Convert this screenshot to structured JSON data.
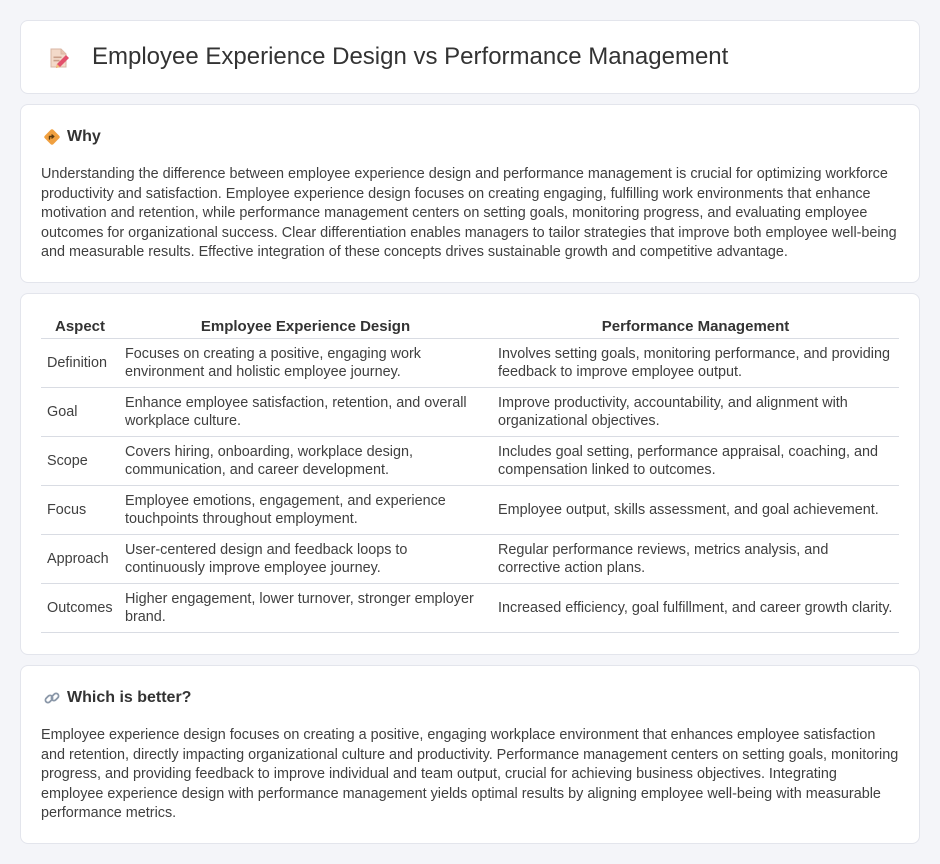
{
  "header": {
    "title": "Employee Experience Design vs Performance Management",
    "icon": "document-pencil-icon"
  },
  "why": {
    "title": "Why",
    "icon": "diamond-direction-icon",
    "text": "Understanding the difference between employee experience design and performance management is crucial for optimizing workforce productivity and satisfaction. Employee experience design focuses on creating engaging, fulfilling work environments that enhance motivation and retention, while performance management centers on setting goals, monitoring progress, and evaluating employee outcomes for organizational success. Clear differentiation enables managers to tailor strategies that improve both employee well-being and measurable results. Effective integration of these concepts drives sustainable growth and competitive advantage."
  },
  "table": {
    "headers": [
      "Aspect",
      "Employee Experience Design",
      "Performance Management"
    ],
    "rows": [
      [
        "Definition",
        "Focuses on creating a positive, engaging work environment and holistic employee journey.",
        "Involves setting goals, monitoring performance, and providing feedback to improve employee output."
      ],
      [
        "Goal",
        "Enhance employee satisfaction, retention, and overall workplace culture.",
        "Improve productivity, accountability, and alignment with organizational objectives."
      ],
      [
        "Scope",
        "Covers hiring, onboarding, workplace design, communication, and career development.",
        "Includes goal setting, performance appraisal, coaching, and compensation linked to outcomes."
      ],
      [
        "Focus",
        "Employee emotions, engagement, and experience touchpoints throughout employment.",
        "Employee output, skills assessment, and goal achievement."
      ],
      [
        "Approach",
        "User-centered design and feedback loops to continuously improve employee journey.",
        "Regular performance reviews, metrics analysis, and corrective action plans."
      ],
      [
        "Outcomes",
        "Higher engagement, lower turnover, stronger employer brand.",
        "Increased efficiency, goal fulfillment, and career growth clarity."
      ]
    ]
  },
  "better": {
    "title": "Which is better?",
    "icon": "link-icon",
    "text": "Employee experience design focuses on creating a positive, engaging workplace environment that enhances employee satisfaction and retention, directly impacting organizational culture and productivity. Performance management centers on setting goals, monitoring progress, and providing feedback to improve individual and team output, crucial for achieving business objectives. Integrating employee experience design with performance management yields optimal results by aligning employee well-being with measurable performance metrics."
  },
  "colors": {
    "background": "#f4f5f9",
    "card": "#ffffff",
    "border": "#e3e5ec",
    "accent_orange": "#f0a040",
    "icon_pink": "#e2506c"
  }
}
